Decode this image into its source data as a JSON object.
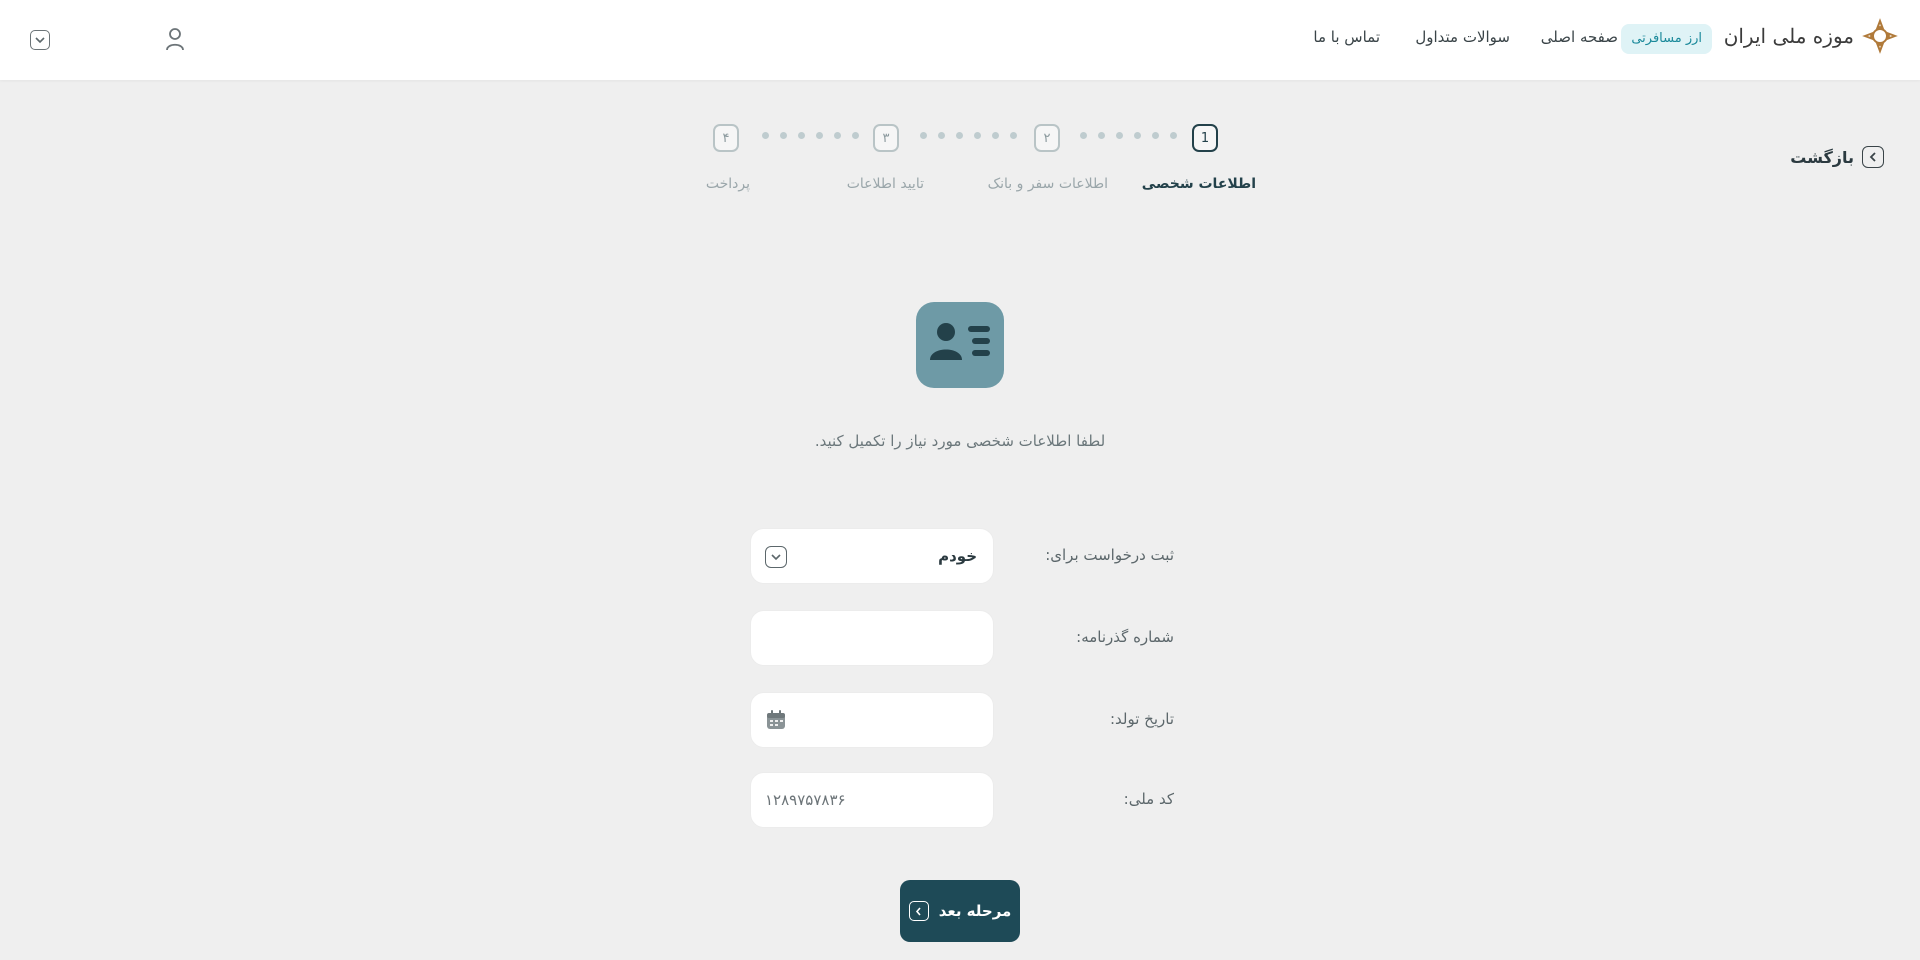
{
  "header": {
    "logo_text": "موزه ملی ایران",
    "badge": "ارز مسافرتی",
    "nav": {
      "home": "صفحه اصلی",
      "faq": "سوالات متداول",
      "contact": "تماس با ما"
    },
    "icons": {
      "user": "user-icon",
      "dropdown": "chevron-down-icon"
    }
  },
  "back": {
    "label": "بازگشت",
    "icon": "chevron-left-icon"
  },
  "stepper": {
    "steps": [
      {
        "number": "1",
        "label": "اطلاعات شخصی",
        "active": true
      },
      {
        "number": "۲",
        "label": "اطلاعات سفر و بانک",
        "active": false
      },
      {
        "number": "۳",
        "label": "تایید اطلاعات",
        "active": false
      },
      {
        "number": "۴",
        "label": "پرداخت",
        "active": false
      }
    ]
  },
  "hero": {
    "icon": "id-card-icon"
  },
  "subtitle": "لطفا اطلاعات شخصی مورد نیاز را تکمیل کنید.",
  "form": {
    "request_for": {
      "label": "ثبت درخواست برای:",
      "value": "خودم"
    },
    "passport": {
      "label": "شماره گذرنامه:",
      "value": ""
    },
    "birth_date": {
      "label": "تاریخ تولد:",
      "value": ""
    },
    "national_code": {
      "label": "کد ملی:",
      "value": "۱۲۸۹۷۵۷۸۳۶"
    }
  },
  "next_button": {
    "label": "مرحله بعد"
  },
  "colors": {
    "primary": "#1e4a57",
    "accent": "#6e9aa6",
    "background": "#efefef",
    "badge_bg": "#dff3f6"
  }
}
